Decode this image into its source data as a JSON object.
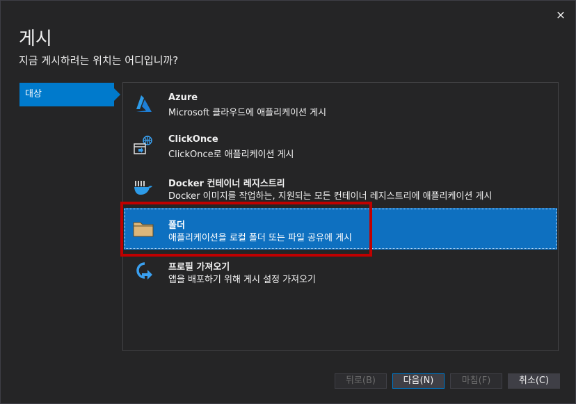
{
  "dialog": {
    "title": "게시",
    "subtitle": "지금 게시하려는 위치는 어디입니까?",
    "close_label": "×"
  },
  "nav": {
    "items": [
      {
        "label": "대상",
        "selected": true
      }
    ]
  },
  "targets": [
    {
      "title": "Azure",
      "description": "Microsoft 클라우드에 애플리케이션 게시",
      "icon": "azure-icon",
      "selected": false
    },
    {
      "title": "ClickOnce",
      "description": "ClickOnce로 애플리케이션 게시",
      "icon": "clickonce-icon",
      "selected": false
    },
    {
      "title": "Docker 컨테이너 레지스트리",
      "description": "Docker 이미지를 작업하는, 지원되는 모든 컨테이너 레지스트리에 애플리케이션 게시",
      "icon": "docker-icon",
      "selected": false
    },
    {
      "title": "폴더",
      "description": "애플리케이션을 로컬 폴더 또는 파일 공유에 게시",
      "icon": "folder-icon",
      "selected": true
    },
    {
      "title": "프로필 가져오기",
      "description": "앱을 배포하기 위해 게시 설정 가져오기",
      "icon": "import-profile-icon",
      "selected": false
    }
  ],
  "footer": {
    "back_label": "뒤로(B)",
    "next_label": "다음(N)",
    "finish_label": "마침(F)",
    "cancel_label": "취소(C)"
  },
  "colors": {
    "accent": "#007acc",
    "selected_bg": "#0e70c0",
    "highlight": "#c00000",
    "background": "#252526"
  }
}
